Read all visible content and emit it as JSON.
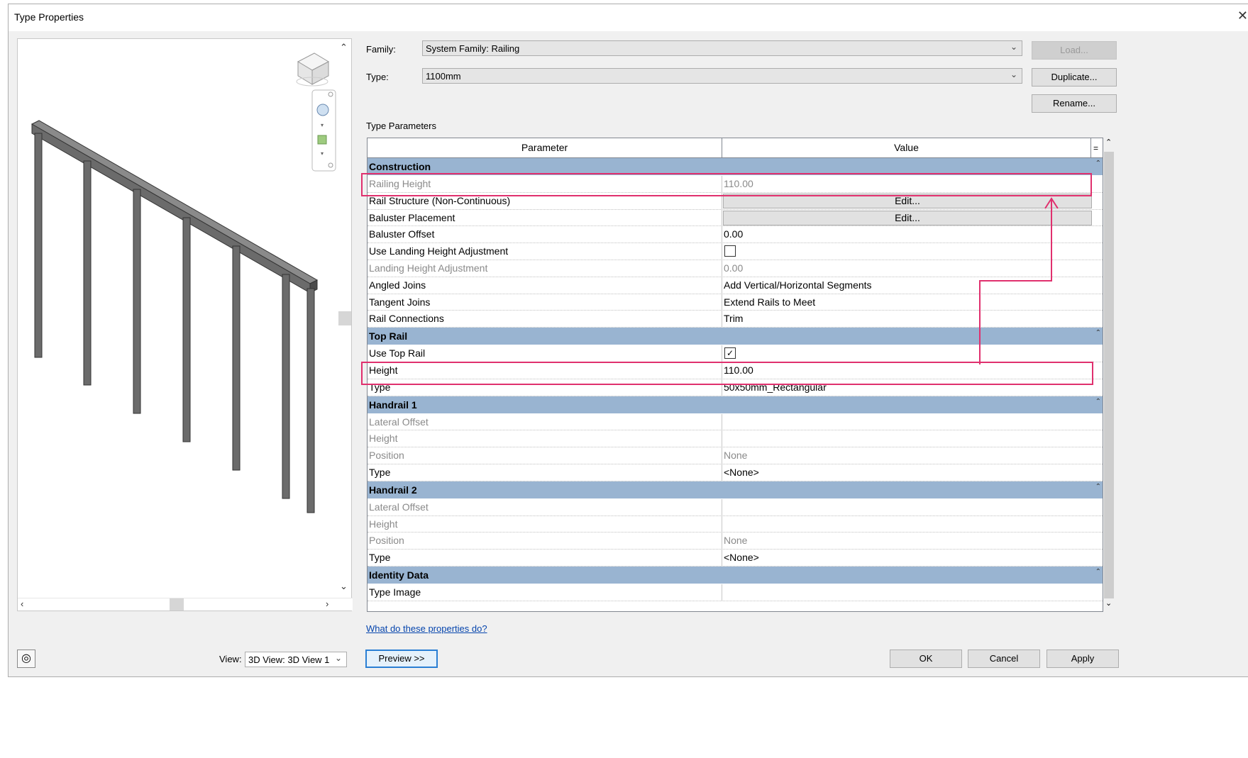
{
  "window": {
    "title": "Type Properties"
  },
  "family": {
    "label": "Family:",
    "value": "System Family: Railing"
  },
  "type": {
    "label": "Type:",
    "value": "1100mm"
  },
  "buttons": {
    "load": "Load...",
    "duplicate": "Duplicate...",
    "rename": "Rename...",
    "preview": "Preview >>",
    "ok": "OK",
    "cancel": "Cancel",
    "apply": "Apply"
  },
  "section_label": "Type Parameters",
  "grid": {
    "headers": {
      "parameter": "Parameter",
      "value": "Value",
      "eq": "="
    },
    "groups": [
      {
        "name": "Construction",
        "rows": [
          {
            "param": "Railing Height",
            "value": "110.00",
            "dim": true
          },
          {
            "param": "Rail Structure (Non-Continuous)",
            "value": "Edit...",
            "kind": "button"
          },
          {
            "param": "Baluster Placement",
            "value": "Edit...",
            "kind": "button"
          },
          {
            "param": "Baluster Offset",
            "value": "0.00"
          },
          {
            "param": "Use Landing Height Adjustment",
            "value": "",
            "kind": "checkbox",
            "checked": false
          },
          {
            "param": "Landing Height Adjustment",
            "value": "0.00",
            "dim": true
          },
          {
            "param": "Angled Joins",
            "value": "Add Vertical/Horizontal Segments"
          },
          {
            "param": "Tangent Joins",
            "value": "Extend Rails to Meet"
          },
          {
            "param": "Rail Connections",
            "value": "Trim"
          }
        ]
      },
      {
        "name": "Top Rail",
        "rows": [
          {
            "param": "Use Top Rail",
            "value": "",
            "kind": "checkbox",
            "checked": true
          },
          {
            "param": "Height",
            "value": "110.00"
          },
          {
            "param": "Type",
            "value": "50x50mm_Rectangular"
          }
        ]
      },
      {
        "name": "Handrail 1",
        "rows": [
          {
            "param": "Lateral Offset",
            "value": "",
            "dim": true
          },
          {
            "param": "Height",
            "value": "",
            "dim": true
          },
          {
            "param": "Position",
            "value": "None",
            "dim": true
          },
          {
            "param": "Type",
            "value": "<None>"
          }
        ]
      },
      {
        "name": "Handrail 2",
        "rows": [
          {
            "param": "Lateral Offset",
            "value": "",
            "dim": true
          },
          {
            "param": "Height",
            "value": "",
            "dim": true
          },
          {
            "param": "Position",
            "value": "None",
            "dim": true
          },
          {
            "param": "Type",
            "value": "<None>"
          }
        ]
      },
      {
        "name": "Identity Data",
        "rows": [
          {
            "param": "Type Image",
            "value": ""
          }
        ]
      }
    ]
  },
  "help_link": "What do these properties do?",
  "view": {
    "label": "View:",
    "value": "3D View: 3D View 1"
  },
  "colors": {
    "group_header": "#99b4d1",
    "highlight": "#e0306e",
    "railing": "#6b6b6b"
  },
  "icons": [
    "close-icon",
    "view-cube-icon",
    "navigation-wheel-icon",
    "zoom-icon",
    "chevron-down-icon",
    "collapse-icon",
    "checkbox-icon",
    "steering-wheel-icon"
  ]
}
